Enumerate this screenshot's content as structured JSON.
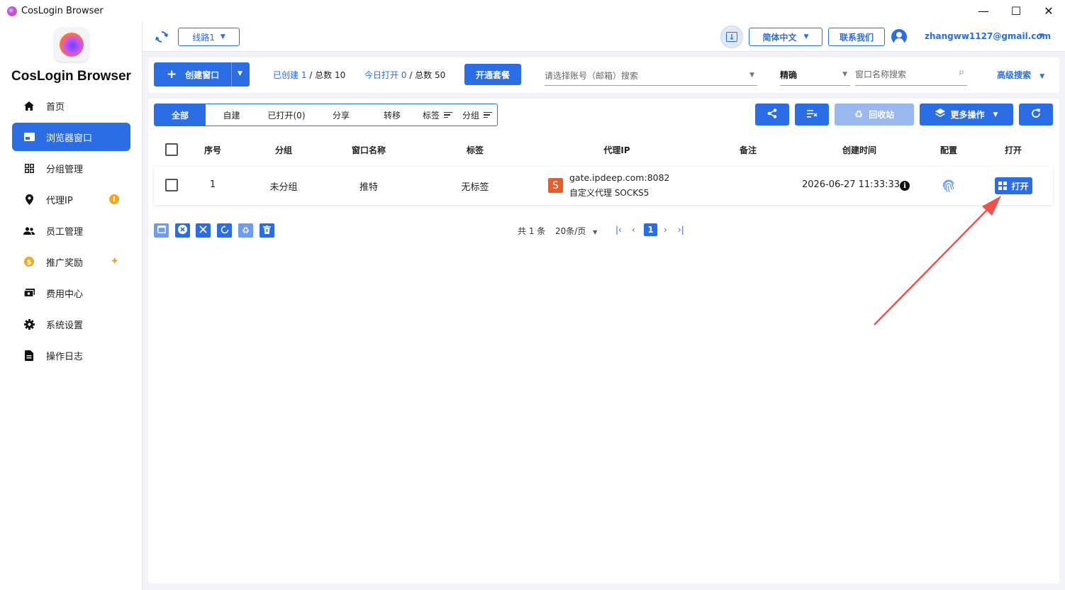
{
  "window": {
    "title": "CosLogin Browser",
    "controls": [
      "—",
      "☐",
      "✕"
    ]
  },
  "brand": {
    "name": "CosLogin Browser"
  },
  "sidebar": {
    "items": [
      {
        "label": "首页",
        "icon": "home-icon"
      },
      {
        "label": "浏览器窗口",
        "icon": "browser-window-icon",
        "active": true
      },
      {
        "label": "分组管理",
        "icon": "grid-icon"
      },
      {
        "label": "代理IP",
        "icon": "location-pin-icon",
        "badge": "!"
      },
      {
        "label": "员工管理",
        "icon": "people-icon"
      },
      {
        "label": "推广奖励",
        "icon": "dollar-coin-icon",
        "sparkle": "✦"
      },
      {
        "label": "费用中心",
        "icon": "billing-icon"
      },
      {
        "label": "系统设置",
        "icon": "gear-icon"
      },
      {
        "label": "操作日志",
        "icon": "document-icon"
      }
    ]
  },
  "header": {
    "route": "线路1",
    "language": "简体中文",
    "contact": "联系我们",
    "user_email": "zhangww1127@gmail.com"
  },
  "toolbar": {
    "create_label": "创建窗口",
    "created_label": "已创建",
    "created_count": "1",
    "created_total": "/ 总数 10",
    "opened_label": "今日打开",
    "opened_count": "0",
    "opened_total": "/ 总数 50",
    "plan_label": "开通套餐",
    "account_placeholder": "请选择账号（邮箱）搜索",
    "match_mode": "精确",
    "name_search_placeholder": "窗口名称搜索",
    "advanced_search": "高级搜索"
  },
  "tabs": [
    {
      "label": "全部",
      "active": true
    },
    {
      "label": "自建"
    },
    {
      "label": "已打开(0)"
    },
    {
      "label": "分享"
    },
    {
      "label": "转移"
    },
    {
      "label": "标签"
    },
    {
      "label": "分组"
    }
  ],
  "actions": {
    "recycle_label": "回收站",
    "more_label": "更多操作"
  },
  "table": {
    "columns": [
      "序号",
      "分组",
      "窗口名称",
      "标签",
      "代理IP",
      "备注",
      "创建时间",
      "配置",
      "打开"
    ],
    "rows": [
      {
        "index": "1",
        "group": "未分组",
        "name": "推特",
        "tag": "无标签",
        "proxy_host": "gate.ipdeep.com:8082",
        "proxy_type": "自定义代理 SOCKS5",
        "note": "",
        "created": "2026-06-27 11:33:33",
        "open_label": "打开"
      }
    ]
  },
  "pagination": {
    "total": "共 1 条",
    "page_size": "20条/页",
    "current_page": "1"
  },
  "colors": {
    "accent": "#2b6de5",
    "warning": "#f5a623",
    "proxy_badge": "#f05a28",
    "annotation_arrow": "#f0514f"
  }
}
